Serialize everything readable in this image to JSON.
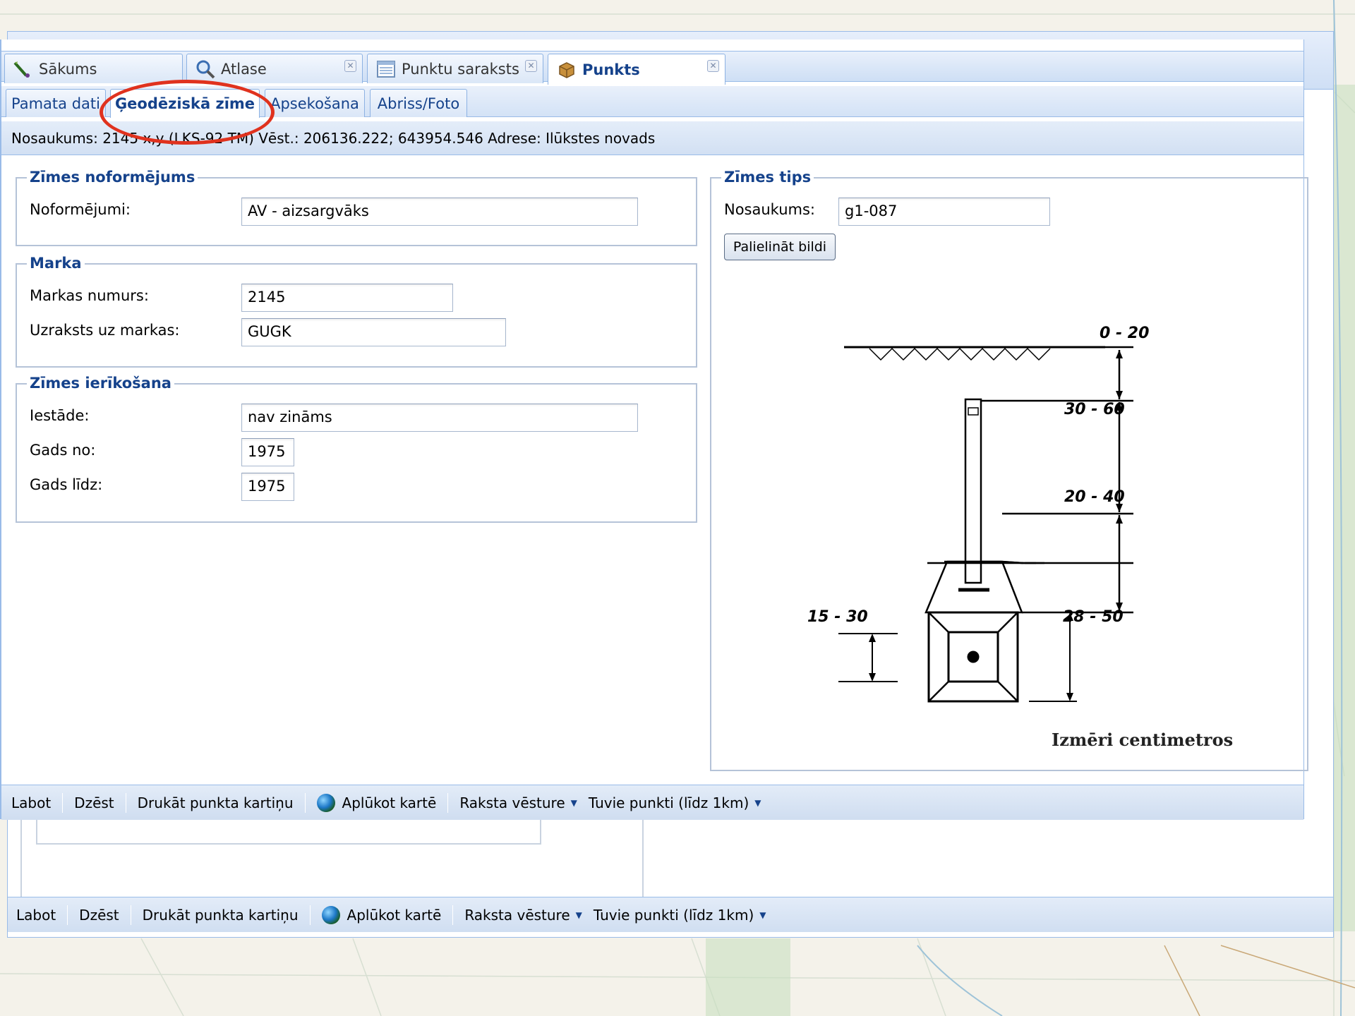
{
  "back_window": {
    "toolbar": {
      "edit": "Labot",
      "delete": "Dzēst",
      "print": "Drukāt punkta kartiņu",
      "view_map": "Aplūkot kartē",
      "history": "Raksta vēsture",
      "nearby": "Tuvie punkti (līdz 1km)"
    }
  },
  "tabs": [
    {
      "label": "Sākums",
      "icon": "wand-icon"
    },
    {
      "label": "Atlase",
      "icon": "magnifier-icon"
    },
    {
      "label": "Punktu saraksts",
      "icon": "list-icon"
    },
    {
      "label": "Punkts",
      "icon": "box-icon"
    }
  ],
  "subtabs": [
    {
      "label": "Pamata dati"
    },
    {
      "label": "Ģeodēziskā zīme"
    },
    {
      "label": "Apsekošana"
    },
    {
      "label": "Abriss/Foto"
    }
  ],
  "infobar": {
    "text": "Nosaukums: 2145 x,y (LKS-92 TM) Vēst.: 206136.222; 643954.546 Adrese: Ilūkstes novads"
  },
  "sign_design": {
    "legend": "Zīmes noformējums",
    "label": "Noformējumi:",
    "value": "AV - aizsargvāks"
  },
  "mark": {
    "legend": "Marka",
    "number_label": "Markas numurs:",
    "number_value": "2145",
    "inscription_label": "Uzraksts uz markas:",
    "inscription_value": "GUGK"
  },
  "installation": {
    "legend": "Zīmes ierīkošana",
    "institution_label": "Iestāde:",
    "institution_value": "nav zināms",
    "year_from_label": "Gads no:",
    "year_from_value": "1975",
    "year_to_label": "Gads līdz:",
    "year_to_value": "1975"
  },
  "sign_type": {
    "legend": "Zīmes tips",
    "name_label": "Nosaukums:",
    "name_value": "g1-087",
    "enlarge_button": "Palielināt bildi",
    "drawing_labels": {
      "top": "0 - 20",
      "middle": "30 - 60",
      "bottom": "20 - 40",
      "plan_left": "15 - 30",
      "plan_right": "28 - 50"
    },
    "caption": "Izmēri centimetros"
  },
  "toolbar": {
    "edit": "Labot",
    "delete": "Dzēst",
    "print": "Drukāt punkta kartiņu",
    "view_map": "Aplūkot kartē",
    "history": "Raksta vēsture",
    "nearby": "Tuvie punkti (līdz 1km)"
  },
  "colors": {
    "accent": "#15428b",
    "annotation": "#e0321e",
    "border": "#99bbe8"
  }
}
